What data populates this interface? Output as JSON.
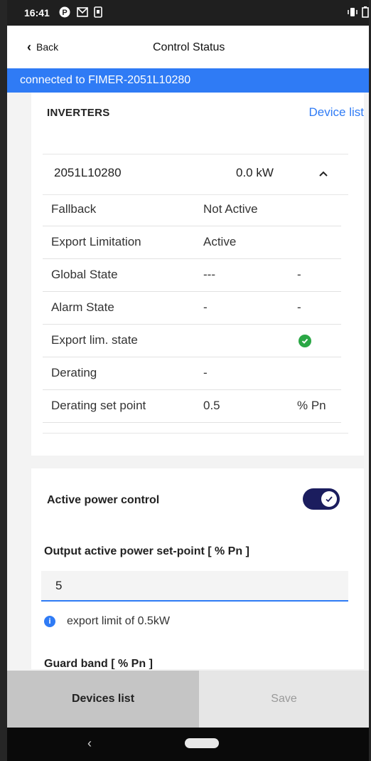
{
  "statusbar": {
    "time": "16:41",
    "icons": [
      "p-icon",
      "gmail-icon",
      "phone-icon",
      "vibrate-icon",
      "battery-icon"
    ]
  },
  "nav": {
    "back_label": "Back",
    "title": "Control Status"
  },
  "banner": {
    "text": "connected to FIMER-2051L10280"
  },
  "inverters": {
    "heading": "INVERTERS",
    "device_list_link": "Device list",
    "inverter": {
      "id": "2051L10280",
      "power": "0.0 kW",
      "expanded": true
    },
    "rows": [
      {
        "label": "Fallback",
        "value": "Not Active",
        "extra": ""
      },
      {
        "label": "Export Limitation",
        "value": "Active",
        "extra": ""
      },
      {
        "label": "Global State",
        "value": "---",
        "extra": "-"
      },
      {
        "label": "Alarm State",
        "value": "-",
        "extra": "-"
      },
      {
        "label": "Export lim. state",
        "value": "",
        "extra": ""
      },
      {
        "label": "Derating",
        "value": "-",
        "extra": ""
      },
      {
        "label": "Derating set point",
        "value": "0.5",
        "extra": "% Pn"
      }
    ]
  },
  "control": {
    "active_power_label": "Active power control",
    "toggle_on": true,
    "setpoint_label": "Output active power set-point [ % Pn ]",
    "setpoint_value": "5",
    "info_text": "export limit of 0.5kW",
    "guard_band_label": "Guard band [ % Pn ]"
  },
  "bottom": {
    "devices_label": "Devices list",
    "save_label": "Save"
  },
  "colors": {
    "accent": "#2f7bf5",
    "toggle": "#1b1d5e",
    "ok": "#2aa745"
  }
}
